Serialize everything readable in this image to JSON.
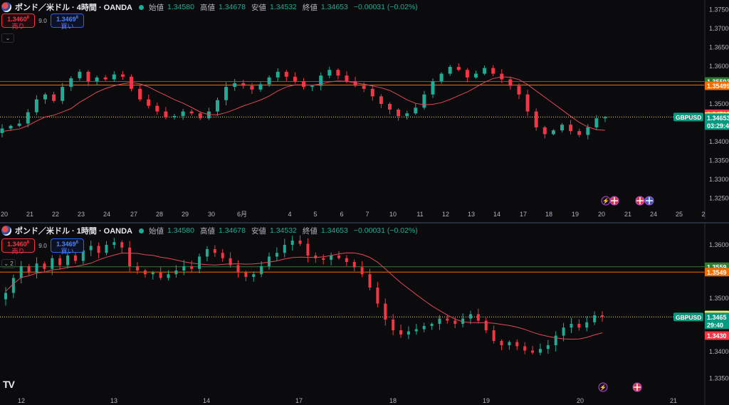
{
  "charts": [
    {
      "id": "top",
      "flag_icon": "gbp-usd-flag-icon",
      "symbol": "ポンド／米ドル · 4時間 · OANDA",
      "ohlc": [
        {
          "label": "始値",
          "value": "1.34580"
        },
        {
          "label": "高値",
          "value": "1.34678"
        },
        {
          "label": "安値",
          "value": "1.34532"
        },
        {
          "label": "終値",
          "value": "1.34653"
        }
      ],
      "change": "−0.00031 (−0.02%)",
      "sell": {
        "price": "1.3460",
        "sup": "8",
        "label": "売り"
      },
      "spread": "9.0",
      "buy": {
        "price": "1.3469",
        "sup": "8",
        "label": "買い"
      },
      "collapse_label": "⌄",
      "y_ticks": [
        "1.37500",
        "1.37000",
        "1.36500",
        "1.36000",
        "1.35500",
        "1.35000",
        "1.34500",
        "1.34000",
        "1.33500",
        "1.33000",
        "1.32500"
      ],
      "x_ticks": [
        "20",
        "21",
        "22",
        "23",
        "24",
        "27",
        "28",
        "29",
        "30",
        "6月",
        "4",
        "5",
        "6",
        "7",
        "10",
        "11",
        "12",
        "13",
        "14",
        "17",
        "18",
        "19",
        "20",
        "21",
        "24",
        "25",
        "2"
      ],
      "price_badges": [
        {
          "text": "1.35593",
          "color": "#2e7d32"
        },
        {
          "text": "1.35499",
          "color": "#ef6c00"
        },
        {
          "text": "1.34719",
          "color": "#f23645"
        },
        {
          "text": "1.34665",
          "color": "#f5e663"
        },
        {
          "text": "1.34653",
          "color": "#089981"
        },
        {
          "text": "03:29:4",
          "color": "#089981"
        }
      ],
      "symbol_badge": "GBPUSD",
      "event_icons": [
        "lightning-icon",
        "gbp-flag-icon",
        "gbp-flag-icon",
        "usd-flag-icon"
      ]
    },
    {
      "id": "bottom",
      "flag_icon": "gbp-usd-flag-icon",
      "symbol": "ポンド／米ドル · 1時間 · OANDA",
      "ohlc": [
        {
          "label": "始値",
          "value": "1.34580"
        },
        {
          "label": "高値",
          "value": "1.34678"
        },
        {
          "label": "安値",
          "value": "1.34532"
        },
        {
          "label": "終値",
          "value": "1.34653"
        }
      ],
      "change": "−0.00031 (−0.02%)",
      "sell": {
        "price": "1.3460",
        "sup": "8",
        "label": "売り"
      },
      "spread": "9.0",
      "buy": {
        "price": "1.3469",
        "sup": "8",
        "label": "買い"
      },
      "collapse_label": "⌄ 2",
      "y_ticks": [
        "1.36000",
        "1.35500",
        "1.35000",
        "1.34500",
        "1.34000",
        "1.33500"
      ],
      "x_ticks": [
        "12",
        "13",
        "14",
        "17",
        "18",
        "19",
        "20",
        "21"
      ],
      "price_badges": [
        {
          "text": "1.3559",
          "color": "#2e7d32"
        },
        {
          "text": "1.3549",
          "color": "#ef6c00"
        },
        {
          "text": "1.3466",
          "color": "#f5e663"
        },
        {
          "text": "1.3465",
          "color": "#089981"
        },
        {
          "text": "29:40",
          "color": "#089981"
        },
        {
          "text": "1.3430",
          "color": "#f23645"
        }
      ],
      "symbol_badge": "GBPUSD",
      "event_icons": [
        "lightning-icon",
        "gbp-flag-icon"
      ],
      "logo": "TV"
    }
  ],
  "colors": {
    "up": "#22ab94",
    "down": "#f23645",
    "ma": "#e0485a",
    "green_line": "#2e7d32",
    "orange_line": "#ef6c00",
    "price_line": "#f5e663",
    "axis_text": "#b2b5be"
  },
  "chart_data": [
    {
      "type": "candlestick",
      "title": "ポンド／米ドル · 4時間 · OANDA",
      "ylim": [
        1.3225,
        1.3775
      ],
      "close_path": [
        1.3435,
        1.3442,
        1.3448,
        1.3478,
        1.3512,
        1.3525,
        1.3508,
        1.3545,
        1.3568,
        1.3585,
        1.356,
        1.357,
        1.3565,
        1.3578,
        1.3572,
        1.354,
        1.3512,
        1.3495,
        1.348,
        1.3465,
        1.3468,
        1.348,
        1.3475,
        1.3462,
        1.348,
        1.351,
        1.3545,
        1.3555,
        1.3548,
        1.3538,
        1.3552,
        1.357,
        1.3585,
        1.3572,
        1.356,
        1.3545,
        1.3548,
        1.3575,
        1.359,
        1.3575,
        1.356,
        1.3548,
        1.354,
        1.352,
        1.35,
        1.3485,
        1.3468,
        1.3475,
        1.349,
        1.3525,
        1.356,
        1.358,
        1.3598,
        1.359,
        1.357,
        1.358,
        1.3595,
        1.358,
        1.3565,
        1.3548,
        1.3525,
        1.348,
        1.3438,
        1.342,
        1.343,
        1.3445,
        1.3428,
        1.3418,
        1.3438,
        1.3462,
        1.3465
      ],
      "annotations": {
        "green_line": 1.35593,
        "orange_line": 1.35499,
        "last_price": 1.34653,
        "high_line": 1.34719,
        "ask_line": 1.34665
      }
    },
    {
      "type": "candlestick",
      "title": "ポンド／米ドル · 1時間 · OANDA",
      "ylim": [
        1.332,
        1.364
      ],
      "close_path": [
        1.351,
        1.3538,
        1.356,
        1.3548,
        1.3565,
        1.3555,
        1.3575,
        1.3562,
        1.358,
        1.357,
        1.359,
        1.3598,
        1.3585,
        1.36,
        1.3605,
        1.3595,
        1.356,
        1.3552,
        1.3545,
        1.3548,
        1.3538,
        1.3545,
        1.3552,
        1.356,
        1.3555,
        1.3578,
        1.3592,
        1.3585,
        1.3575,
        1.3562,
        1.3548,
        1.354,
        1.3545,
        1.356,
        1.3578,
        1.3585,
        1.36,
        1.3608,
        1.3602,
        1.358,
        1.3575,
        1.3572,
        1.358,
        1.3575,
        1.3568,
        1.3558,
        1.3545,
        1.352,
        1.349,
        1.346,
        1.344,
        1.3432,
        1.3438,
        1.3442,
        1.3448,
        1.3452,
        1.3462,
        1.3458,
        1.3452,
        1.3462,
        1.347,
        1.3458,
        1.344,
        1.342,
        1.3412,
        1.3418,
        1.341,
        1.3402,
        1.3398,
        1.3405,
        1.3412,
        1.343,
        1.3445,
        1.3452,
        1.3445,
        1.3455,
        1.3468,
        1.3465
      ],
      "annotations": {
        "green_line": 1.3559,
        "orange_line": 1.3549,
        "last_price": 1.3465,
        "ask_line": 1.3466,
        "low_line": 1.343
      }
    }
  ]
}
